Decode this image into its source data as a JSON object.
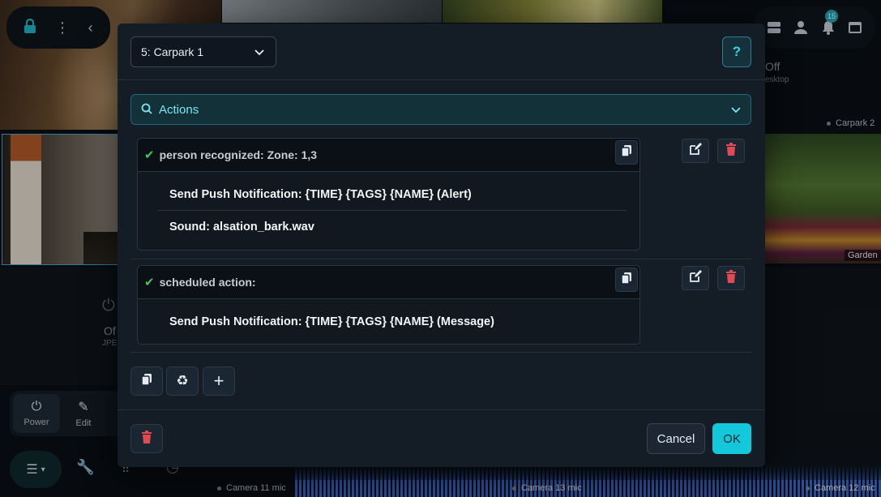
{
  "background": {
    "tiles": {
      "carpark2_label": "Carpark 2",
      "garden_label": "Garden",
      "off_label": "Off",
      "desktop_label": "esktop",
      "off_label_left": "Of",
      "jpeg_label": "JPE",
      "camera11_label": "Camera 11 mic",
      "camera13_label": "Camera 13 mic",
      "camera12_label": "Camera 12 mic"
    },
    "notification_count": "15",
    "bottom_controls": {
      "power_label": "Power",
      "edit_label": "Edit"
    }
  },
  "modal": {
    "camera_select": {
      "value": "5: Carpark 1"
    },
    "help_label": "?",
    "actions_bar_label": "Actions",
    "rules": [
      {
        "trigger": "person recognized: Zone: 1,3",
        "actions": [
          "Send Push Notification: {TIME} {TAGS} {NAME} (Alert)",
          "Sound: alsation_bark.wav"
        ]
      },
      {
        "trigger": "scheduled action:",
        "actions": [
          "Send Push Notification: {TIME} {TAGS} {NAME} (Message)"
        ]
      }
    ],
    "tools": {
      "add_label": "+"
    },
    "footer": {
      "cancel_label": "Cancel",
      "ok_label": "OK"
    }
  },
  "colors": {
    "accent": "#14c8dc",
    "delete": "#e04a55",
    "success": "#4bbf5a"
  }
}
